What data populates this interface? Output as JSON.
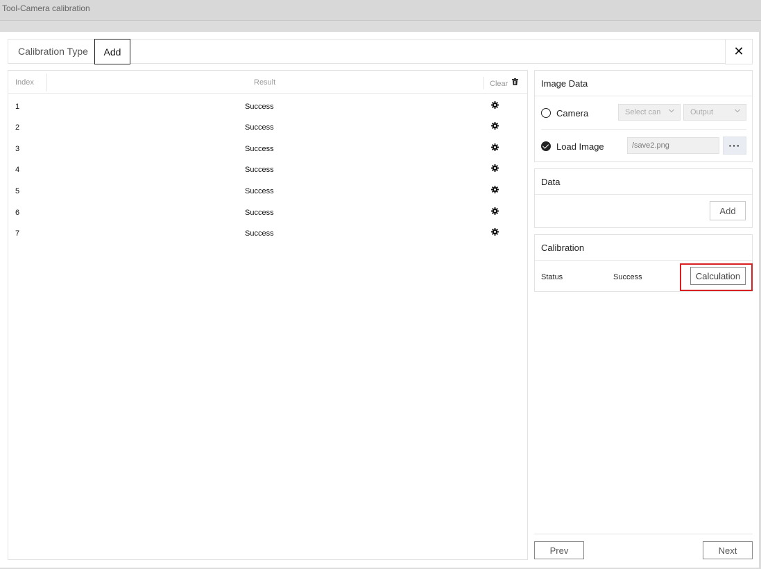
{
  "window": {
    "title": "Tool-Camera calibration"
  },
  "tabs": {
    "type_label": "Calibration Type",
    "add_label": "Add",
    "close_glyph": "✕"
  },
  "table": {
    "headers": {
      "index": "Index",
      "result": "Result",
      "clear": "Clear"
    },
    "rows": [
      {
        "index": "1",
        "result": "Success"
      },
      {
        "index": "2",
        "result": "Success"
      },
      {
        "index": "3",
        "result": "Success"
      },
      {
        "index": "4",
        "result": "Success"
      },
      {
        "index": "5",
        "result": "Success"
      },
      {
        "index": "6",
        "result": "Success"
      },
      {
        "index": "7",
        "result": "Success"
      }
    ]
  },
  "image_data": {
    "title": "Image Data",
    "camera_label": "Camera",
    "camera_select": "Select can",
    "output_select": "Output",
    "load_image_label": "Load Image",
    "file_path": "/save2.png",
    "browse_glyph": "···"
  },
  "data_section": {
    "title": "Data",
    "add_label": "Add"
  },
  "calibration": {
    "title": "Calibration",
    "status_label": "Status",
    "status_value": "Success",
    "calculation_label": "Calculation"
  },
  "footer": {
    "prev_label": "Prev",
    "next_label": "Next"
  },
  "colors": {
    "highlight": "#d91f1f",
    "border": "#e2e2e2"
  },
  "icons": {
    "row_action": "gear-icon",
    "clear": "trash-icon",
    "close": "close-icon"
  }
}
